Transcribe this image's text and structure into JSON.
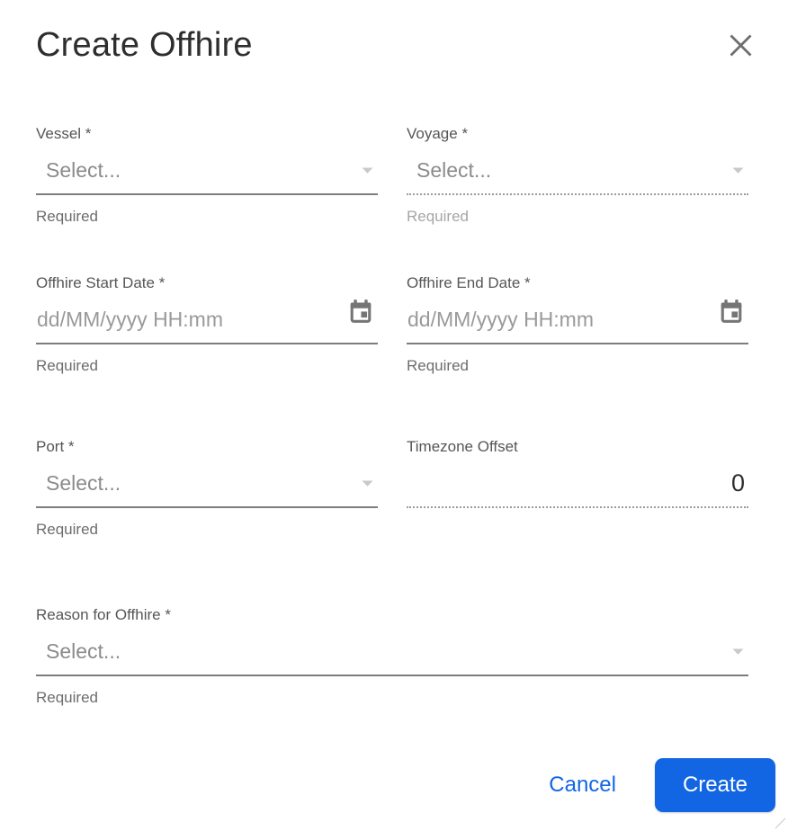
{
  "dialog": {
    "title": "Create Offhire"
  },
  "fields": {
    "vessel": {
      "label": "Vessel *",
      "placeholder": "Select...",
      "helper": "Required",
      "disabled": false
    },
    "voyage": {
      "label": "Voyage *",
      "placeholder": "Select...",
      "helper": "Required",
      "disabled": true
    },
    "start_date": {
      "label": "Offhire Start Date *",
      "placeholder": "dd/MM/yyyy HH:mm",
      "helper": "Required",
      "disabled": false
    },
    "end_date": {
      "label": "Offhire End Date *",
      "placeholder": "dd/MM/yyyy HH:mm",
      "helper": "Required",
      "disabled": false
    },
    "port": {
      "label": "Port *",
      "placeholder": "Select...",
      "helper": "Required",
      "disabled": false
    },
    "timezone_offset": {
      "label": "Timezone Offset",
      "value": "0",
      "disabled": true
    },
    "reason": {
      "label": "Reason for Offhire *",
      "placeholder": "Select...",
      "helper": "Required",
      "disabled": false
    }
  },
  "footer": {
    "cancel_label": "Cancel",
    "create_label": "Create"
  },
  "icons": {
    "close": "close-x",
    "calendar": "calendar",
    "dropdown": "chevron-down"
  },
  "colors": {
    "primary_blue": "#1266e3",
    "icon_gray": "#757575",
    "underline_solid": "#7d7d7d",
    "underline_dotted": "#9c9c9c",
    "placeholder_gray": "#8b8b8b"
  }
}
